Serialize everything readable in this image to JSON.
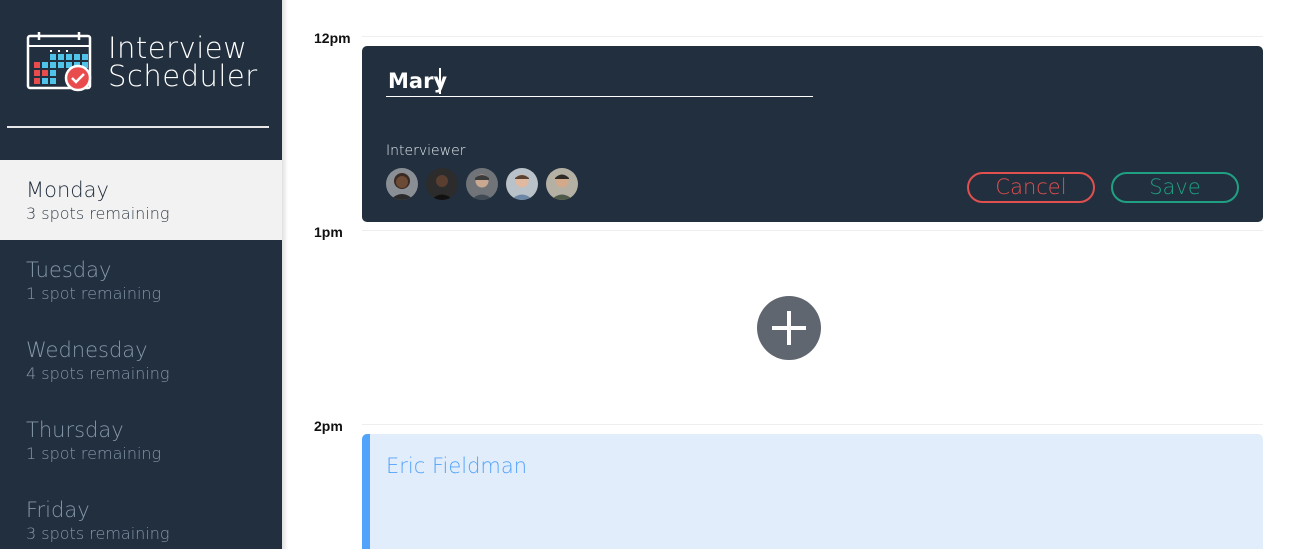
{
  "app": {
    "title_line1": "Interview",
    "title_line2": "Scheduler"
  },
  "days": [
    {
      "name": "Monday",
      "spots": "3 spots remaining",
      "selected": true
    },
    {
      "name": "Tuesday",
      "spots": "1 spot remaining",
      "selected": false
    },
    {
      "name": "Wednesday",
      "spots": "4 spots remaining",
      "selected": false
    },
    {
      "name": "Thursday",
      "spots": "1 spot remaining",
      "selected": false
    },
    {
      "name": "Friday",
      "spots": "3 spots remaining",
      "selected": false
    }
  ],
  "times": [
    "12pm",
    "1pm",
    "2pm"
  ],
  "form": {
    "student_name": "Mary",
    "interviewer_label": "Interviewer",
    "interviewers": [
      {
        "icon": "interviewer-avatar-1"
      },
      {
        "icon": "interviewer-avatar-2"
      },
      {
        "icon": "interviewer-avatar-3"
      },
      {
        "icon": "interviewer-avatar-4"
      },
      {
        "icon": "interviewer-avatar-5"
      }
    ],
    "cancel_label": "Cancel",
    "save_label": "Save"
  },
  "appointment": {
    "student": "Eric Fieldman"
  },
  "colors": {
    "sidebar_bg": "#222f3e",
    "cancel": "#e0504e",
    "save": "#1fa083",
    "appointment_accent": "#52a3fa"
  }
}
